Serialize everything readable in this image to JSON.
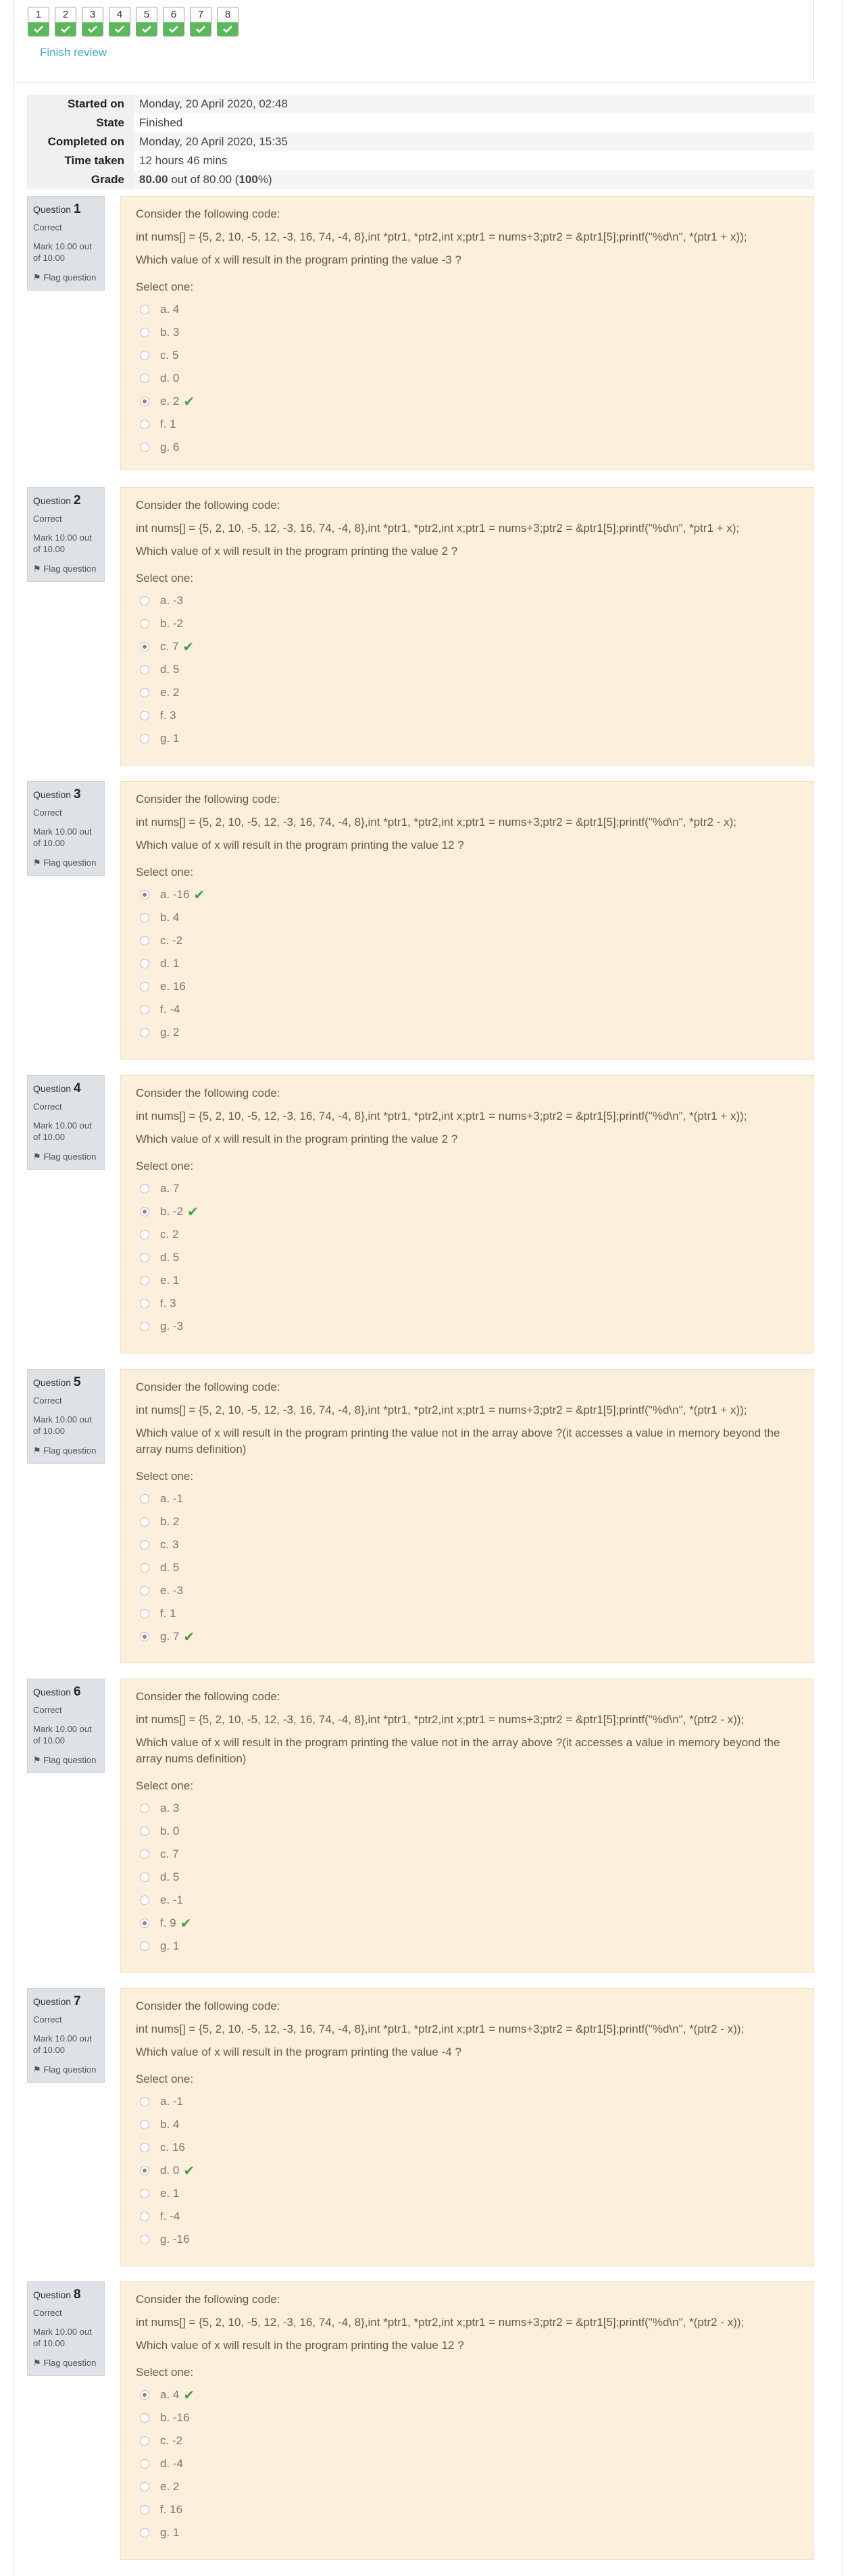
{
  "navigation": {
    "buttons": [
      "1",
      "2",
      "3",
      "4",
      "5",
      "6",
      "7",
      "8"
    ],
    "finish_review": "Finish review"
  },
  "summary": {
    "rows": [
      {
        "label": "Started on",
        "value": "Monday, 20 April 2020, 02:48"
      },
      {
        "label": "State",
        "value": "Finished"
      },
      {
        "label": "Completed on",
        "value": "Monday, 20 April 2020, 15:35"
      },
      {
        "label": "Time taken",
        "value": "12 hours 46 mins"
      }
    ],
    "grade_label": "Grade",
    "grade_value": "80.00",
    "grade_out_of": "out of 80.00 (",
    "grade_percent": "100",
    "grade_end": "%)"
  },
  "question_common": {
    "question_word": "Question",
    "state": "Correct",
    "mark": "Mark 10.00 out of 10.00",
    "flag": "Flag question",
    "intro": "Consider the following code:",
    "select_one": "Select one:"
  },
  "questions": [
    {
      "number": "1",
      "code": "int nums[] = {5, 2, 10, -5, 12, -3, 16, 74, -4, 8},int *ptr1, *ptr2,int x;ptr1 = nums+3;ptr2 = &ptr1[5];printf(\"%d\\n\", *(ptr1 + x));",
      "prompt": "Which value of x will result in the program printing the value -3 ?",
      "options": [
        "a. 4",
        "b. 3",
        "c. 5",
        "d. 0",
        "e. 2",
        "f. 1",
        "g. 6"
      ],
      "selected": 4
    },
    {
      "number": "2",
      "code": "int nums[] = {5, 2, 10, -5, 12, -3, 16, 74, -4, 8},int *ptr1, *ptr2,int x;ptr1 = nums+3;ptr2 = &ptr1[5];printf(\"%d\\n\", *ptr1 + x);",
      "prompt": "Which value of x will result in the program printing the value 2 ?",
      "options": [
        "a. -3",
        "b. -2",
        "c. 7",
        "d. 5",
        "e. 2",
        "f. 3",
        "g. 1"
      ],
      "selected": 2
    },
    {
      "number": "3",
      "code": "int nums[] = {5, 2, 10, -5, 12, -3, 16, 74, -4, 8},int *ptr1, *ptr2,int x;ptr1 = nums+3;ptr2 = &ptr1[5];printf(\"%d\\n\", *ptr2 - x);",
      "prompt": "Which value of x will result in the program printing the value 12 ?",
      "options": [
        "a. -16",
        "b. 4",
        "c. -2",
        "d. 1",
        "e. 16",
        "f. -4",
        "g. 2"
      ],
      "selected": 0
    },
    {
      "number": "4",
      "code": "int nums[] = {5, 2, 10, -5, 12, -3, 16, 74, -4, 8},int *ptr1, *ptr2,int x;ptr1 = nums+3;ptr2 = &ptr1[5];printf(\"%d\\n\", *(ptr1 + x));",
      "prompt": "Which value of x will result in the program printing the value 2 ?",
      "options": [
        "a. 7",
        "b. -2",
        "c. 2",
        "d. 5",
        "e. 1",
        "f. 3",
        "g. -3"
      ],
      "selected": 1
    },
    {
      "number": "5",
      "code": "int nums[] = {5, 2, 10, -5, 12, -3, 16, 74, -4, 8},int *ptr1, *ptr2,int x;ptr1 = nums+3;ptr2 = &ptr1[5];printf(\"%d\\n\", *(ptr1 + x));",
      "prompt": "Which value of x will result in the program printing the value not in the array above ?(it accesses a value in memory beyond the array nums definition)",
      "options": [
        "a. -1",
        "b. 2",
        "c. 3",
        "d. 5",
        "e. -3",
        "f. 1",
        "g. 7"
      ],
      "selected": 6
    },
    {
      "number": "6",
      "code": "int nums[] = {5, 2, 10, -5, 12, -3, 16, 74, -4, 8},int *ptr1, *ptr2,int x;ptr1 = nums+3;ptr2 = &ptr1[5];printf(\"%d\\n\", *(ptr2 - x));",
      "prompt": "Which value of x will result in the program printing the value not in the array above ?(it accesses a value in memory beyond the array nums definition)",
      "options": [
        "a. 3",
        "b. 0",
        "c. 7",
        "d. 5",
        "e. -1",
        "f. 9",
        "g. 1"
      ],
      "selected": 5
    },
    {
      "number": "7",
      "code": "int nums[] = {5, 2, 10, -5, 12, -3, 16, 74, -4, 8},int *ptr1, *ptr2,int x;ptr1 = nums+3;ptr2 = &ptr1[5];printf(\"%d\\n\", *(ptr2 - x));",
      "prompt": "Which value of x will result in the program printing the value -4 ?",
      "options": [
        "a. -1",
        "b. 4",
        "c. 16",
        "d. 0",
        "e. 1",
        "f. -4",
        "g. -16"
      ],
      "selected": 3
    },
    {
      "number": "8",
      "code": "int nums[] = {5, 2, 10, -5, 12, -3, 16, 74, -4, 8},int *ptr1, *ptr2,int x;ptr1 = nums+3;ptr2 = &ptr1[5];printf(\"%d\\n\", *(ptr2 - x));",
      "prompt": "Which value of x will result in the program printing the value 12 ?",
      "options": [
        "a. 4",
        "b. -16",
        "c. -2",
        "d. -4",
        "e. 2",
        "f. 16",
        "g. 1"
      ],
      "selected": 0
    }
  ]
}
